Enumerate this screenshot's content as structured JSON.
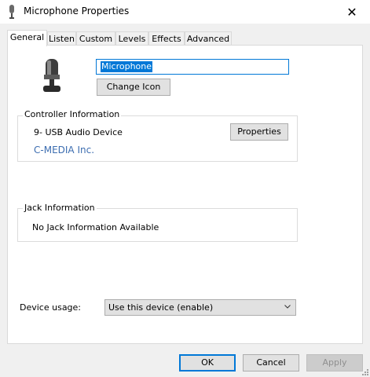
{
  "window": {
    "title": "Microphone Properties",
    "close_glyph": "✕"
  },
  "tabs": [
    {
      "label": "General",
      "active": true
    },
    {
      "label": "Listen"
    },
    {
      "label": "Custom"
    },
    {
      "label": "Levels"
    },
    {
      "label": "Effects"
    },
    {
      "label": "Advanced"
    }
  ],
  "general": {
    "device_name_value": "Microphone",
    "change_icon_label": "Change Icon",
    "controller": {
      "group_label": "Controller Information",
      "device": "9- USB Audio Device",
      "vendor": "C-MEDIA Inc.",
      "properties_label": "Properties"
    },
    "jack": {
      "group_label": "Jack Information",
      "text": "No Jack Information Available"
    },
    "usage": {
      "label": "Device usage:",
      "selected": "Use this device (enable)"
    }
  },
  "footer": {
    "ok": "OK",
    "cancel": "Cancel",
    "apply": "Apply"
  },
  "colors": {
    "accent": "#0078d7",
    "link": "#3c6db0"
  },
  "icons": [
    "microphone-icon",
    "close-icon",
    "chevron-down-icon",
    "resize-grip-icon"
  ]
}
